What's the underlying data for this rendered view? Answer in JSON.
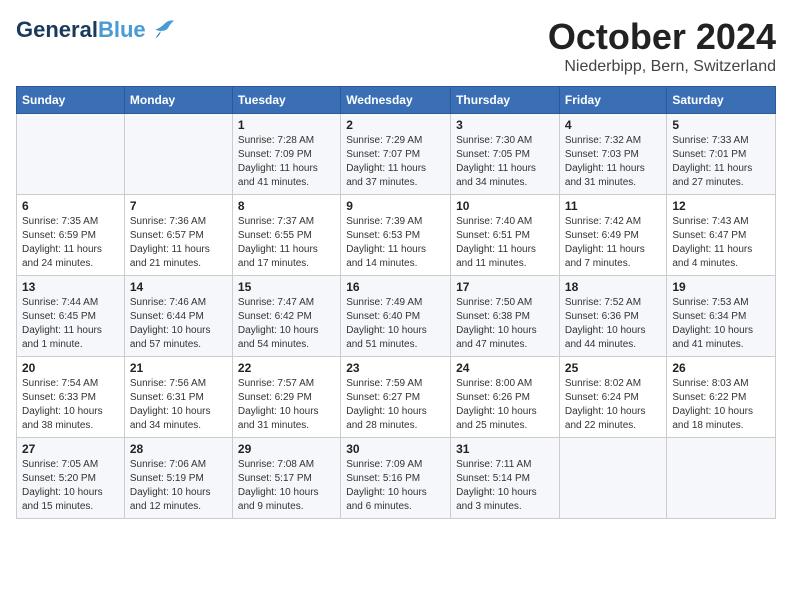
{
  "header": {
    "logo_line1": "General",
    "logo_line2": "Blue",
    "month": "October 2024",
    "location": "Niederbipp, Bern, Switzerland"
  },
  "weekdays": [
    "Sunday",
    "Monday",
    "Tuesday",
    "Wednesday",
    "Thursday",
    "Friday",
    "Saturday"
  ],
  "weeks": [
    [
      {
        "day": "",
        "sunrise": "",
        "sunset": "",
        "daylight": ""
      },
      {
        "day": "",
        "sunrise": "",
        "sunset": "",
        "daylight": ""
      },
      {
        "day": "1",
        "sunrise": "Sunrise: 7:28 AM",
        "sunset": "Sunset: 7:09 PM",
        "daylight": "Daylight: 11 hours and 41 minutes."
      },
      {
        "day": "2",
        "sunrise": "Sunrise: 7:29 AM",
        "sunset": "Sunset: 7:07 PM",
        "daylight": "Daylight: 11 hours and 37 minutes."
      },
      {
        "day": "3",
        "sunrise": "Sunrise: 7:30 AM",
        "sunset": "Sunset: 7:05 PM",
        "daylight": "Daylight: 11 hours and 34 minutes."
      },
      {
        "day": "4",
        "sunrise": "Sunrise: 7:32 AM",
        "sunset": "Sunset: 7:03 PM",
        "daylight": "Daylight: 11 hours and 31 minutes."
      },
      {
        "day": "5",
        "sunrise": "Sunrise: 7:33 AM",
        "sunset": "Sunset: 7:01 PM",
        "daylight": "Daylight: 11 hours and 27 minutes."
      }
    ],
    [
      {
        "day": "6",
        "sunrise": "Sunrise: 7:35 AM",
        "sunset": "Sunset: 6:59 PM",
        "daylight": "Daylight: 11 hours and 24 minutes."
      },
      {
        "day": "7",
        "sunrise": "Sunrise: 7:36 AM",
        "sunset": "Sunset: 6:57 PM",
        "daylight": "Daylight: 11 hours and 21 minutes."
      },
      {
        "day": "8",
        "sunrise": "Sunrise: 7:37 AM",
        "sunset": "Sunset: 6:55 PM",
        "daylight": "Daylight: 11 hours and 17 minutes."
      },
      {
        "day": "9",
        "sunrise": "Sunrise: 7:39 AM",
        "sunset": "Sunset: 6:53 PM",
        "daylight": "Daylight: 11 hours and 14 minutes."
      },
      {
        "day": "10",
        "sunrise": "Sunrise: 7:40 AM",
        "sunset": "Sunset: 6:51 PM",
        "daylight": "Daylight: 11 hours and 11 minutes."
      },
      {
        "day": "11",
        "sunrise": "Sunrise: 7:42 AM",
        "sunset": "Sunset: 6:49 PM",
        "daylight": "Daylight: 11 hours and 7 minutes."
      },
      {
        "day": "12",
        "sunrise": "Sunrise: 7:43 AM",
        "sunset": "Sunset: 6:47 PM",
        "daylight": "Daylight: 11 hours and 4 minutes."
      }
    ],
    [
      {
        "day": "13",
        "sunrise": "Sunrise: 7:44 AM",
        "sunset": "Sunset: 6:45 PM",
        "daylight": "Daylight: 11 hours and 1 minute."
      },
      {
        "day": "14",
        "sunrise": "Sunrise: 7:46 AM",
        "sunset": "Sunset: 6:44 PM",
        "daylight": "Daylight: 10 hours and 57 minutes."
      },
      {
        "day": "15",
        "sunrise": "Sunrise: 7:47 AM",
        "sunset": "Sunset: 6:42 PM",
        "daylight": "Daylight: 10 hours and 54 minutes."
      },
      {
        "day": "16",
        "sunrise": "Sunrise: 7:49 AM",
        "sunset": "Sunset: 6:40 PM",
        "daylight": "Daylight: 10 hours and 51 minutes."
      },
      {
        "day": "17",
        "sunrise": "Sunrise: 7:50 AM",
        "sunset": "Sunset: 6:38 PM",
        "daylight": "Daylight: 10 hours and 47 minutes."
      },
      {
        "day": "18",
        "sunrise": "Sunrise: 7:52 AM",
        "sunset": "Sunset: 6:36 PM",
        "daylight": "Daylight: 10 hours and 44 minutes."
      },
      {
        "day": "19",
        "sunrise": "Sunrise: 7:53 AM",
        "sunset": "Sunset: 6:34 PM",
        "daylight": "Daylight: 10 hours and 41 minutes."
      }
    ],
    [
      {
        "day": "20",
        "sunrise": "Sunrise: 7:54 AM",
        "sunset": "Sunset: 6:33 PM",
        "daylight": "Daylight: 10 hours and 38 minutes."
      },
      {
        "day": "21",
        "sunrise": "Sunrise: 7:56 AM",
        "sunset": "Sunset: 6:31 PM",
        "daylight": "Daylight: 10 hours and 34 minutes."
      },
      {
        "day": "22",
        "sunrise": "Sunrise: 7:57 AM",
        "sunset": "Sunset: 6:29 PM",
        "daylight": "Daylight: 10 hours and 31 minutes."
      },
      {
        "day": "23",
        "sunrise": "Sunrise: 7:59 AM",
        "sunset": "Sunset: 6:27 PM",
        "daylight": "Daylight: 10 hours and 28 minutes."
      },
      {
        "day": "24",
        "sunrise": "Sunrise: 8:00 AM",
        "sunset": "Sunset: 6:26 PM",
        "daylight": "Daylight: 10 hours and 25 minutes."
      },
      {
        "day": "25",
        "sunrise": "Sunrise: 8:02 AM",
        "sunset": "Sunset: 6:24 PM",
        "daylight": "Daylight: 10 hours and 22 minutes."
      },
      {
        "day": "26",
        "sunrise": "Sunrise: 8:03 AM",
        "sunset": "Sunset: 6:22 PM",
        "daylight": "Daylight: 10 hours and 18 minutes."
      }
    ],
    [
      {
        "day": "27",
        "sunrise": "Sunrise: 7:05 AM",
        "sunset": "Sunset: 5:20 PM",
        "daylight": "Daylight: 10 hours and 15 minutes."
      },
      {
        "day": "28",
        "sunrise": "Sunrise: 7:06 AM",
        "sunset": "Sunset: 5:19 PM",
        "daylight": "Daylight: 10 hours and 12 minutes."
      },
      {
        "day": "29",
        "sunrise": "Sunrise: 7:08 AM",
        "sunset": "Sunset: 5:17 PM",
        "daylight": "Daylight: 10 hours and 9 minutes."
      },
      {
        "day": "30",
        "sunrise": "Sunrise: 7:09 AM",
        "sunset": "Sunset: 5:16 PM",
        "daylight": "Daylight: 10 hours and 6 minutes."
      },
      {
        "day": "31",
        "sunrise": "Sunrise: 7:11 AM",
        "sunset": "Sunset: 5:14 PM",
        "daylight": "Daylight: 10 hours and 3 minutes."
      },
      {
        "day": "",
        "sunrise": "",
        "sunset": "",
        "daylight": ""
      },
      {
        "day": "",
        "sunrise": "",
        "sunset": "",
        "daylight": ""
      }
    ]
  ]
}
